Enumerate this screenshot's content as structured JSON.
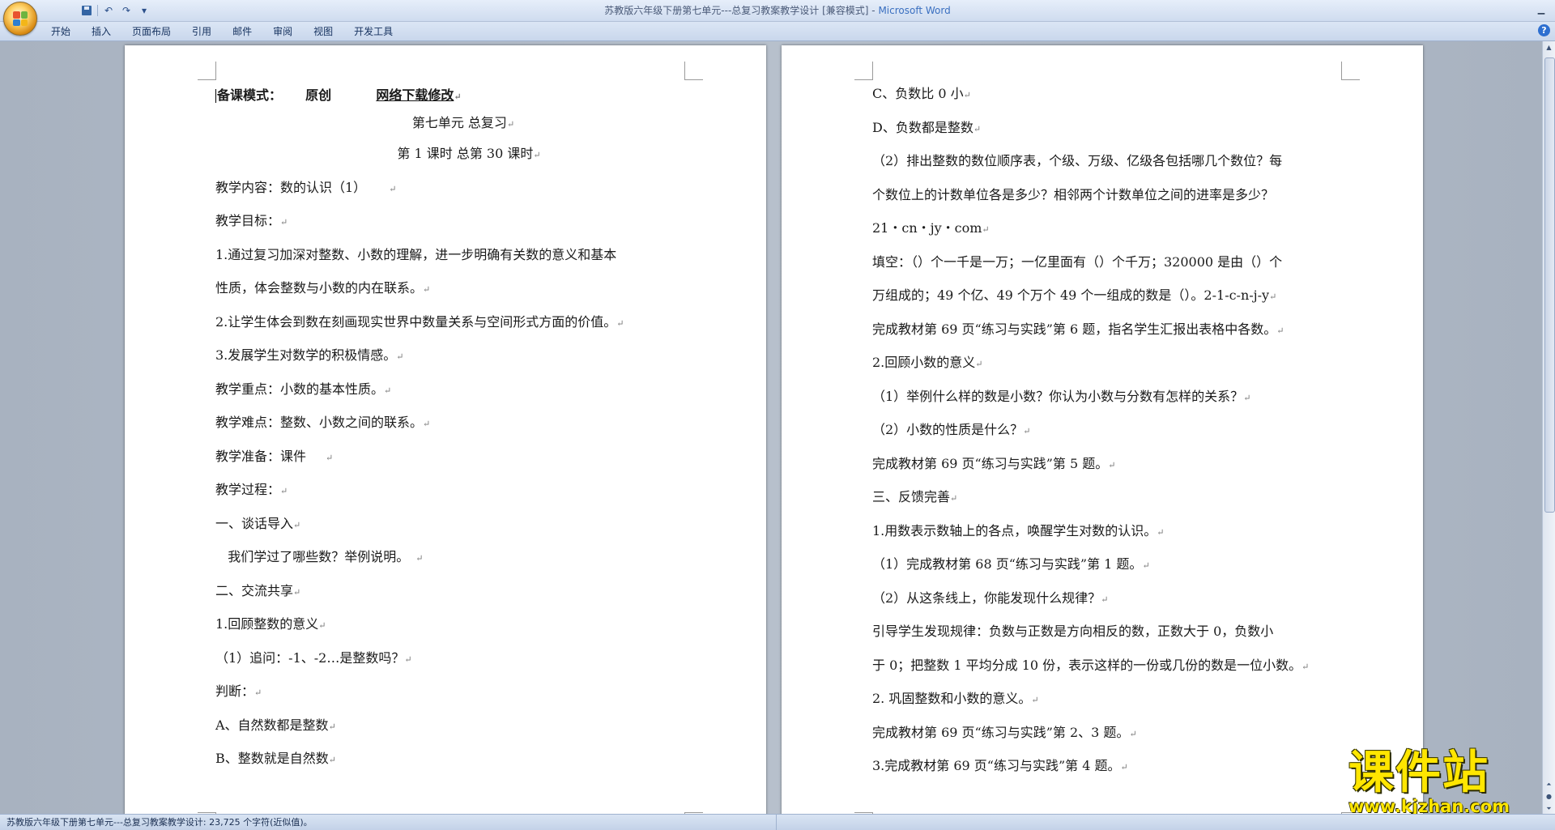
{
  "window": {
    "title": "苏教版六年级下册第七单元---总复习教案教学设计 [兼容模式] -",
    "app_name": "Microsoft Word"
  },
  "quick_access": {
    "save": "save-icon",
    "undo": "↶",
    "redo": "↷",
    "customize": "▾"
  },
  "ribbon_tabs": [
    "开始",
    "插入",
    "页面布局",
    "引用",
    "邮件",
    "审阅",
    "视图",
    "开发工具"
  ],
  "help": "?",
  "paragraph_mark": "↵",
  "left_page": {
    "header_label": "备课模式：",
    "header_option1": "原创",
    "header_option2": "网络下载修改",
    "unit_title": "第七单元   总复习",
    "lesson_line": "第 1 课时      总第  30   课时",
    "lines": [
      "教学内容：数的认识（1）",
      "教学目标：",
      "1.通过复习加深对整数、小数的理解，进一步明确有关数的意义和基本",
      "性质，体会整数与小数的内在联系。",
      "2.让学生体会到数在刻画现实世界中数量关系与空间形式方面的价值。",
      "3.发展学生对数学的积极情感。",
      "教学重点：小数的基本性质。",
      "教学难点：整数、小数之间的联系。",
      "教学准备：课件",
      "教学过程：",
      "一、谈话导入",
      "   我们学过了哪些数？举例说明。",
      "二、交流共享",
      "1.回顾整数的意义",
      "（1）追问：-1、-2…是整数吗？",
      "判断：",
      "A、自然数都是整数",
      "B、整数就是自然数"
    ]
  },
  "right_page": {
    "lines": [
      "C、负数比 0 小",
      "D、负数都是整数",
      "（2）排出整数的数位顺序表，个级、万级、亿级各包括哪几个数位？每",
      "个数位上的计数单位各是多少？相邻两个计数单位之间的进率是多少？",
      "21・cn・jy・com",
      "填空：（）个一千是一万；一亿里面有（）个千万；320000 是由（）个",
      "万组成的；49 个亿、49 个万个 49 个一组成的数是（）。2-1-c-n-j-y",
      "完成教材第 69 页“练习与实践”第 6 题，指名学生汇报出表格中各数。",
      "2.回顾小数的意义",
      "（1）举例什么样的数是小数？你认为小数与分数有怎样的关系？",
      "（2）小数的性质是什么？",
      "完成教材第 69 页“练习与实践”第 5 题。",
      "三、反馈完善",
      "1.用数表示数轴上的各点，唤醒学生对数的认识。",
      "（1）完成教材第 68 页“练习与实践”第 1 题。",
      "（2）从这条线上，你能发现什么规律？",
      "引导学生发现规律：负数与正数是方向相反的数，正数大于 0，负数小",
      "于 0；把整数 1 平均分成 10 份，表示这样的一份或几份的数是一位小数。",
      "2. 巩固整数和小数的意义。",
      "完成教材第 69 页“练习与实践”第 2、3 题。",
      "3.完成教材第 69 页“练习与实践”第 4 题。"
    ]
  },
  "status_bar": {
    "text": "苏教版六年级下册第七单元---总复习教案教学设计: 23,725 个字符(近似值)。"
  },
  "watermark": {
    "main": "课件站",
    "url": "www.kjzhan.com"
  }
}
